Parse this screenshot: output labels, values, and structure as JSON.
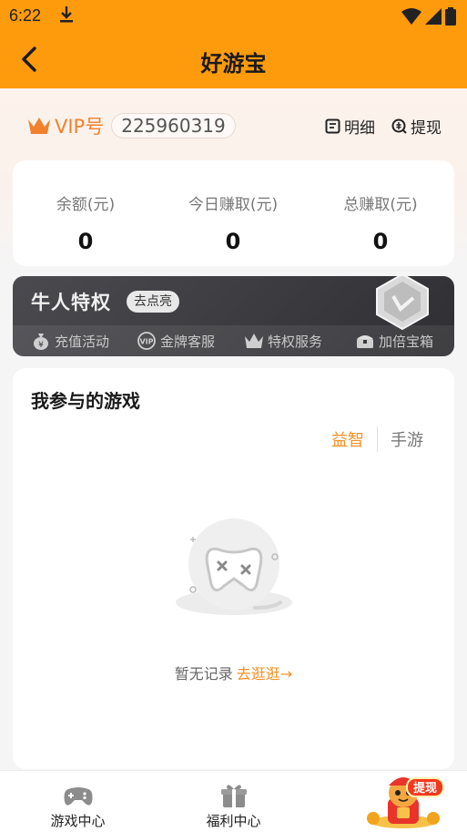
{
  "status_bar": {
    "time": "6:22"
  },
  "nav": {
    "title": "好游宝"
  },
  "vip": {
    "label": "VIP号",
    "number": "225960319"
  },
  "links": {
    "detail": "明细",
    "withdraw": "提现"
  },
  "stats": [
    {
      "label": "余额(元)",
      "value": "0"
    },
    {
      "label": "今日赚取(元)",
      "value": "0"
    },
    {
      "label": "总赚取(元)",
      "value": "0"
    }
  ],
  "privilege": {
    "title": "牛人特权",
    "button": "去点亮",
    "items": [
      {
        "label": "充值活动",
        "icon": "money-bag-icon"
      },
      {
        "label": "金牌客服",
        "icon": "vip-icon"
      },
      {
        "label": "特权服务",
        "icon": "crown-icon"
      },
      {
        "label": "加倍宝箱",
        "icon": "treasure-chest-icon"
      }
    ]
  },
  "games": {
    "title": "我参与的游戏",
    "tabs": [
      {
        "label": "益智",
        "active": true
      },
      {
        "label": "手游",
        "active": false
      }
    ],
    "empty_text": "暂无记录",
    "empty_link": "去逛逛→"
  },
  "tabbar": {
    "items": [
      {
        "label": "游戏中心",
        "icon": "gamepad-icon"
      },
      {
        "label": "福利中心",
        "icon": "gift-icon"
      }
    ],
    "promo_badge": "提现"
  },
  "colors": {
    "header": "#fe9b0c",
    "accent": "#f39024",
    "vip": "#f0812f",
    "privilege_bg": "#3a3a3e"
  }
}
